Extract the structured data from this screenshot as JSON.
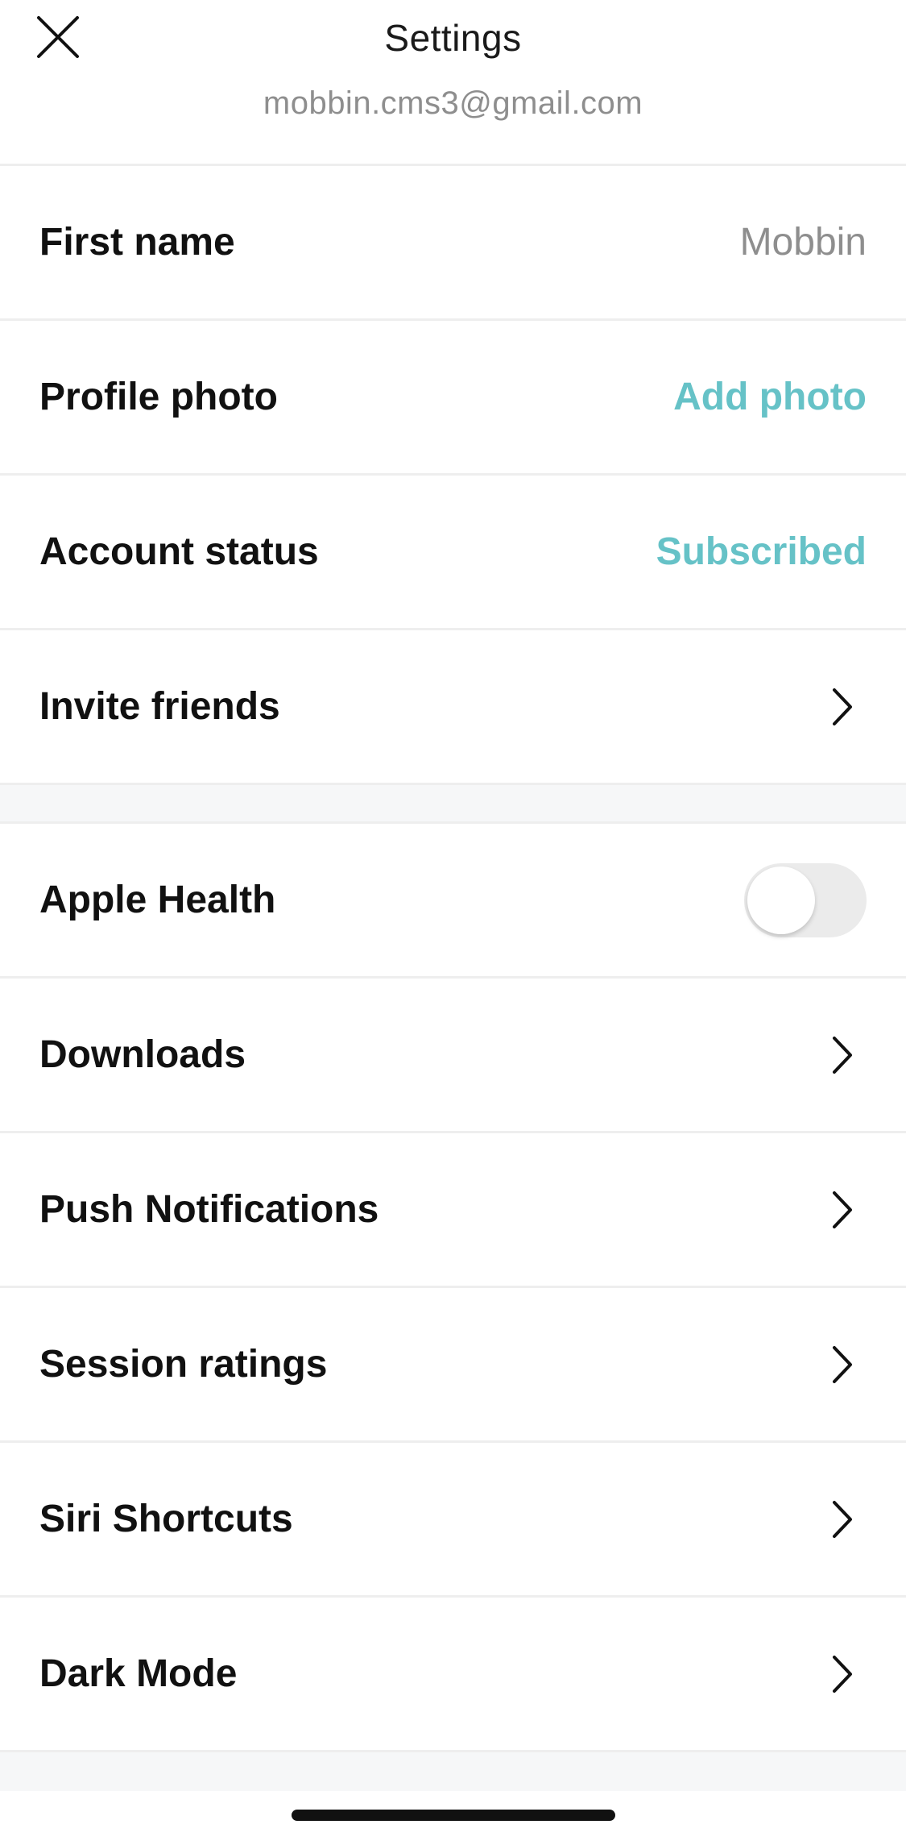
{
  "header": {
    "title": "Settings",
    "email": "mobbin.cms3@gmail.com"
  },
  "rows": {
    "first_name": {
      "label": "First name",
      "value": "Mobbin"
    },
    "profile_photo": {
      "label": "Profile photo",
      "value": "Add photo"
    },
    "account_status": {
      "label": "Account status",
      "value": "Subscribed"
    },
    "invite_friends": {
      "label": "Invite friends"
    },
    "apple_health": {
      "label": "Apple Health",
      "enabled": false
    },
    "downloads": {
      "label": "Downloads"
    },
    "push_notifications": {
      "label": "Push Notifications"
    },
    "session_ratings": {
      "label": "Session ratings"
    },
    "siri_shortcuts": {
      "label": "Siri Shortcuts"
    },
    "dark_mode": {
      "label": "Dark Mode"
    }
  },
  "colors": {
    "accent": "#66c2c7",
    "text_primary": "#111111",
    "text_secondary": "#8e8e8e",
    "divider": "#eeeeee",
    "section_bg": "#f6f7f8"
  },
  "icons": {
    "close": "close-icon",
    "chevron": "chevron-right-icon"
  }
}
